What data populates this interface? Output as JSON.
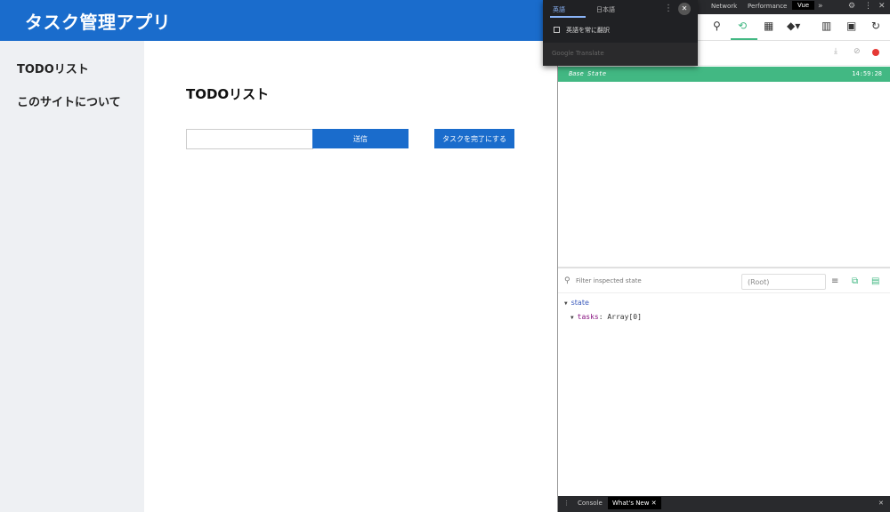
{
  "app": {
    "title": "タスク管理アプリ",
    "nav": [
      "TODOリスト",
      "このサイトについて"
    ],
    "page_title": "TODOリスト",
    "input_value": "",
    "send_button": "送信",
    "complete_button": "タスクを完了にする"
  },
  "translate": {
    "tabs": [
      "英語",
      "日本語"
    ],
    "menu_icon": "⋮",
    "option": "英語を常に翻訳",
    "footer": "Google Translate"
  },
  "devtools": {
    "tabs": [
      "Network",
      "Performance",
      "Vue"
    ],
    "more": "»",
    "base_state": "Base State",
    "timestamp": "14:59:28",
    "filter_placeholder": "Filter inspected state",
    "root_label": "(Root)",
    "tree": {
      "state_key": "state",
      "tasks_key": "tasks",
      "tasks_value": "Array[0]"
    },
    "drawer_tabs": [
      "Console",
      "What's New"
    ]
  },
  "colors": {
    "brand": "#1a6ccc",
    "vue_green": "#42b883"
  }
}
